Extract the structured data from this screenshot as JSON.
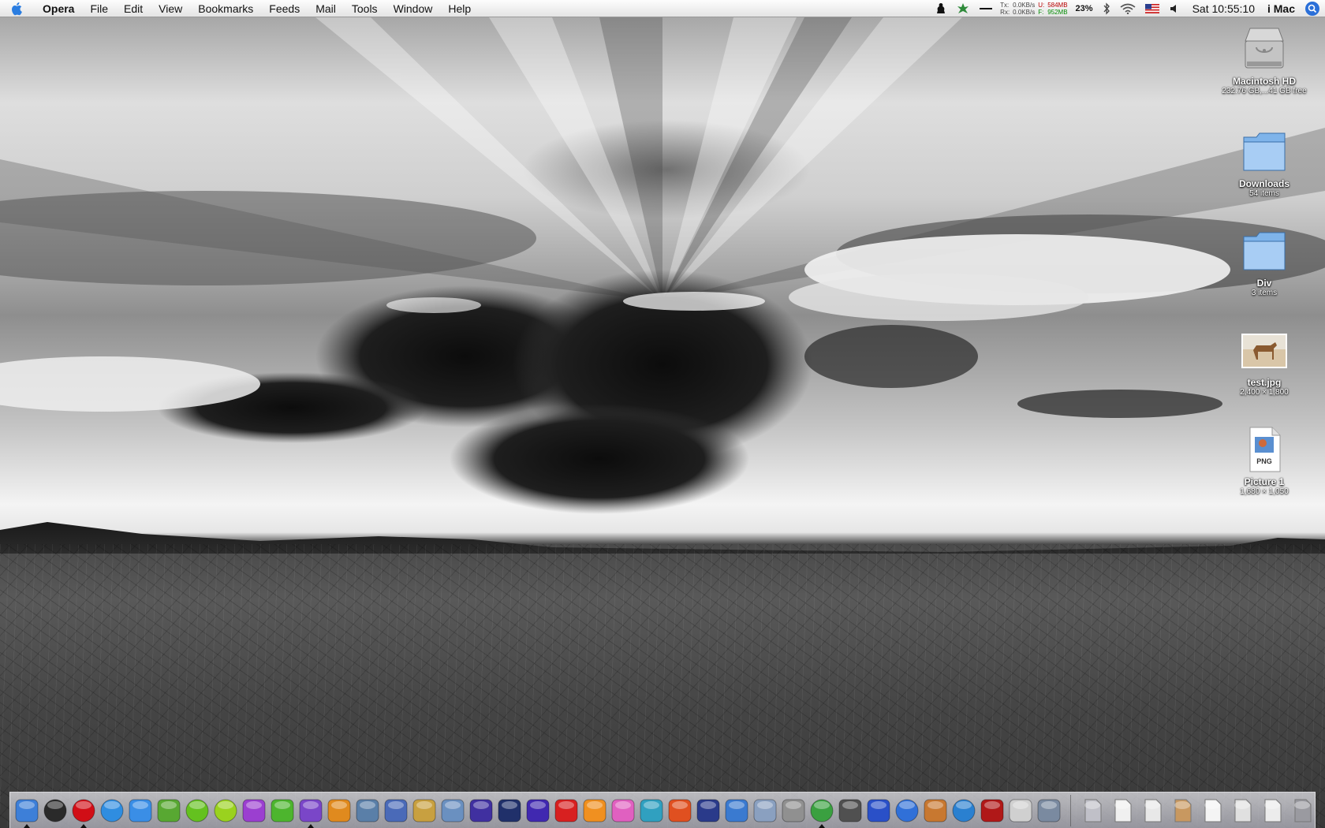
{
  "menubar": {
    "app_name": "Opera",
    "menus": [
      "File",
      "Edit",
      "View",
      "Bookmarks",
      "Feeds",
      "Mail",
      "Tools",
      "Window",
      "Help"
    ],
    "net": {
      "tx_label": "Tx:",
      "tx_value": "0.0KB/s",
      "rx_label": "Rx:",
      "rx_value": "0.0KB/s"
    },
    "memory": {
      "used_label": "U:",
      "used_value": "584MB",
      "free_label": "F:",
      "free_value": "952MB"
    },
    "battery": "23%",
    "clock": "Sat 10:55:10",
    "user": "i Mac"
  },
  "desktop_icons": [
    {
      "label": "Macintosh HD",
      "info": "232.76 GB,...41 GB free",
      "icon": "hard-drive-icon"
    },
    {
      "label": "Downloads",
      "info": "54 items",
      "icon": "folder-icon"
    },
    {
      "label": "Div",
      "info": "3 items",
      "icon": "folder-icon"
    },
    {
      "label": "test.jpg",
      "info": "2,400 × 1,800",
      "icon": "image-file-icon"
    },
    {
      "label": "Picture 1",
      "info": "1,680 × 1,050",
      "icon": "png-file-icon",
      "badge": "PNG"
    }
  ],
  "dock": {
    "apps": [
      {
        "icon": "finder-icon",
        "color": "#3d7fd8",
        "running": true
      },
      {
        "icon": "dashboard-icon",
        "color": "#2a2a2a",
        "running": false
      },
      {
        "icon": "opera-icon",
        "color": "#d10e16",
        "running": true
      },
      {
        "icon": "safari-icon",
        "color": "#2f8de0",
        "running": false
      },
      {
        "icon": "ichat-icon",
        "color": "#3a8ee6",
        "running": false
      },
      {
        "icon": "adium-icon",
        "color": "#58a832",
        "running": false
      },
      {
        "icon": "skype-icon",
        "color": "#64c11f",
        "running": false
      },
      {
        "icon": "app-green-circle-icon",
        "color": "#9ad21e",
        "running": false
      },
      {
        "icon": "app-purple-icon",
        "color": "#9b3fd0",
        "running": false
      },
      {
        "icon": "dreamweaver-icon",
        "color": "#4db52e",
        "running": false
      },
      {
        "icon": "word-icon",
        "color": "#7a46c8",
        "running": true
      },
      {
        "icon": "pages-icon",
        "color": "#e08a1e",
        "running": false
      },
      {
        "icon": "preview-icon",
        "color": "#5a7fa8",
        "running": false
      },
      {
        "icon": "pencil-icon",
        "color": "#4a6ab8",
        "running": false
      },
      {
        "icon": "brush-icon",
        "color": "#c8a040",
        "running": false
      },
      {
        "icon": "script-editor-icon",
        "color": "#6a90c0",
        "running": false
      },
      {
        "icon": "film-icon",
        "color": "#4030a0",
        "running": false
      },
      {
        "icon": "snowflake-icon",
        "color": "#20306a",
        "running": false
      },
      {
        "icon": "photo-app-icon",
        "color": "#4028b0",
        "running": false
      },
      {
        "icon": "acrobat-icon",
        "color": "#d82020",
        "running": false
      },
      {
        "icon": "flower-icon",
        "color": "#f09020",
        "running": false
      },
      {
        "icon": "butterfly-icon",
        "color": "#e060c0",
        "running": false
      },
      {
        "icon": "feather-icon",
        "color": "#30a0c0",
        "running": false
      },
      {
        "icon": "illustrator-icon",
        "color": "#e05020",
        "running": false
      },
      {
        "icon": "star-icon",
        "color": "#2a3a8a",
        "running": false
      },
      {
        "icon": "hammer-icon",
        "color": "#3a7ad0",
        "running": false
      },
      {
        "icon": "xcode-icon",
        "color": "#8aa0c0",
        "running": false
      },
      {
        "icon": "automator-icon",
        "color": "#909090",
        "running": false
      },
      {
        "icon": "itunes-icon",
        "color": "#3aa040",
        "running": true
      },
      {
        "icon": "iphoto-icon",
        "color": "#505050",
        "running": false
      },
      {
        "icon": "imovie-icon",
        "color": "#2a50c8",
        "running": false
      },
      {
        "icon": "idvd-icon",
        "color": "#3070d8",
        "running": false
      },
      {
        "icon": "garageband-icon",
        "color": "#c87830",
        "running": false
      },
      {
        "icon": "quicktime-icon",
        "color": "#2a80d0",
        "running": false
      },
      {
        "icon": "photobooth-icon",
        "color": "#b01818",
        "running": false
      },
      {
        "icon": "bootcamp-icon",
        "color": "#d0d0d0",
        "running": false
      },
      {
        "icon": "system-preferences-icon",
        "color": "#7a8aa0",
        "running": false
      }
    ],
    "docs": [
      {
        "icon": "mail-stack-icon",
        "color": "#c0c0c8"
      },
      {
        "icon": "document-stack-icon",
        "color": "#f0f0f0"
      },
      {
        "icon": "document-stack-icon",
        "color": "#e8e8e8"
      },
      {
        "icon": "box-stack-icon",
        "color": "#c89860"
      },
      {
        "icon": "document-stack-icon",
        "color": "#f4f4f4"
      },
      {
        "icon": "phone-stack-icon",
        "color": "#e0e0e0"
      },
      {
        "icon": "document-stack-icon",
        "color": "#ececec"
      },
      {
        "icon": "trash-icon",
        "color": "#9a9aa0"
      }
    ]
  }
}
